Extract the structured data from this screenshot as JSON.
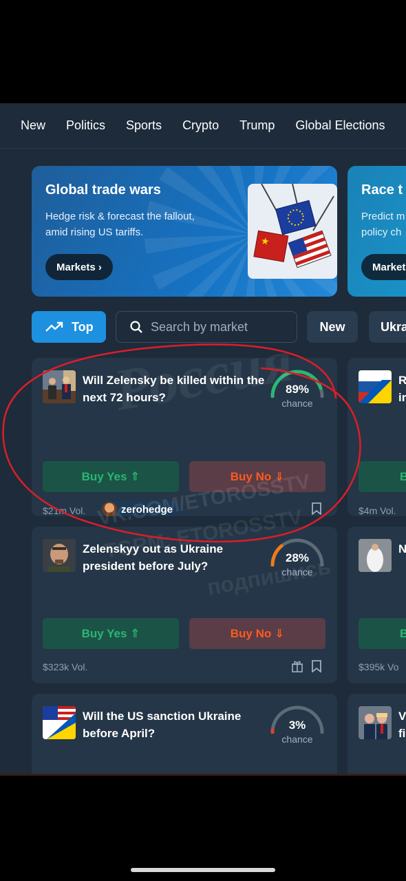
{
  "nav": {
    "items": [
      "New",
      "Politics",
      "Sports",
      "Crypto",
      "Trump",
      "Global Elections"
    ]
  },
  "banners": [
    {
      "title": "Global trade wars",
      "description": "Hedge risk & forecast the fallout, amid rising US tariffs.",
      "button": "Markets ›"
    },
    {
      "title": "Race t",
      "description": "Predict m policy ch",
      "button": "Market"
    }
  ],
  "filters": {
    "top_label": "Top",
    "search_placeholder": "Search by market",
    "new_label": "New",
    "ukraine_label": "Ukra"
  },
  "markets": [
    {
      "question": "Will Zelensky be killed within the next 72 hours?",
      "chance": "89%",
      "chance_value": 0.89,
      "chance_label": "chance",
      "buy_yes": "Buy Yes ⇑",
      "buy_no": "Buy No ⇓",
      "volume": "$21m Vol.",
      "tag": "zerohedge"
    },
    {
      "question": "Zelenskyy out as Ukraine president before July?",
      "chance": "28%",
      "chance_value": 0.28,
      "chance_label": "chance",
      "buy_yes": "Buy Yes ⇑",
      "buy_no": "Buy No ⇓",
      "volume": "$323k Vol."
    },
    {
      "question": "Will the US sanction Ukraine before April?",
      "chance": "3%",
      "chance_value": 0.03,
      "chance_label": "chance"
    }
  ],
  "right_column": {
    "card1": {
      "title_a": "R",
      "title_b": "ir",
      "button": "B",
      "volume": "$4m Vol."
    },
    "card2": {
      "title_a": "N",
      "button": "B",
      "volume": "$395k Vo"
    },
    "card3": {
      "title_a": "V",
      "title_b": "fi"
    }
  },
  "watermark": {
    "line1": "Россия",
    "line2": "VK.COM/ETOROSSTV",
    "line3": "TGRM: ETOROSSTV",
    "line4": "подпишись"
  },
  "colors": {
    "background": "#1d2b3a",
    "card": "#243647",
    "accent": "#1e90e0",
    "yes": "#2bb673",
    "no": "#ff5a1f",
    "annotation": "#d91e2a"
  }
}
